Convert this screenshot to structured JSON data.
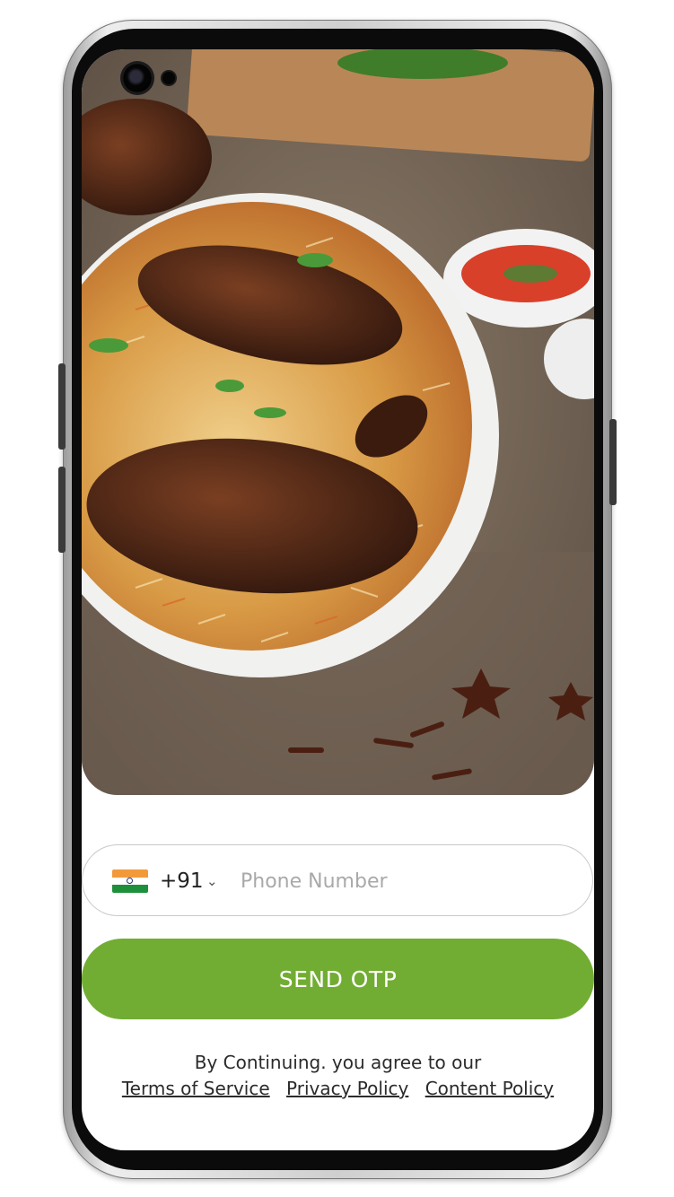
{
  "login": {
    "country_code": "+91",
    "phone_placeholder": "Phone Number",
    "send_otp_label": "SEND OTP",
    "agree_text": "By Continuing. you agree to our",
    "terms_label": "Terms of Service",
    "privacy_label": "Privacy Policy",
    "content_label": "Content Policy"
  },
  "colors": {
    "accent": "#72ad33",
    "text": "#2b2b2b",
    "placeholder": "#a9a9a9",
    "border": "#c9c9c9"
  },
  "icons": {
    "country_flag": "india-flag-icon",
    "dropdown": "chevron-down-icon"
  }
}
